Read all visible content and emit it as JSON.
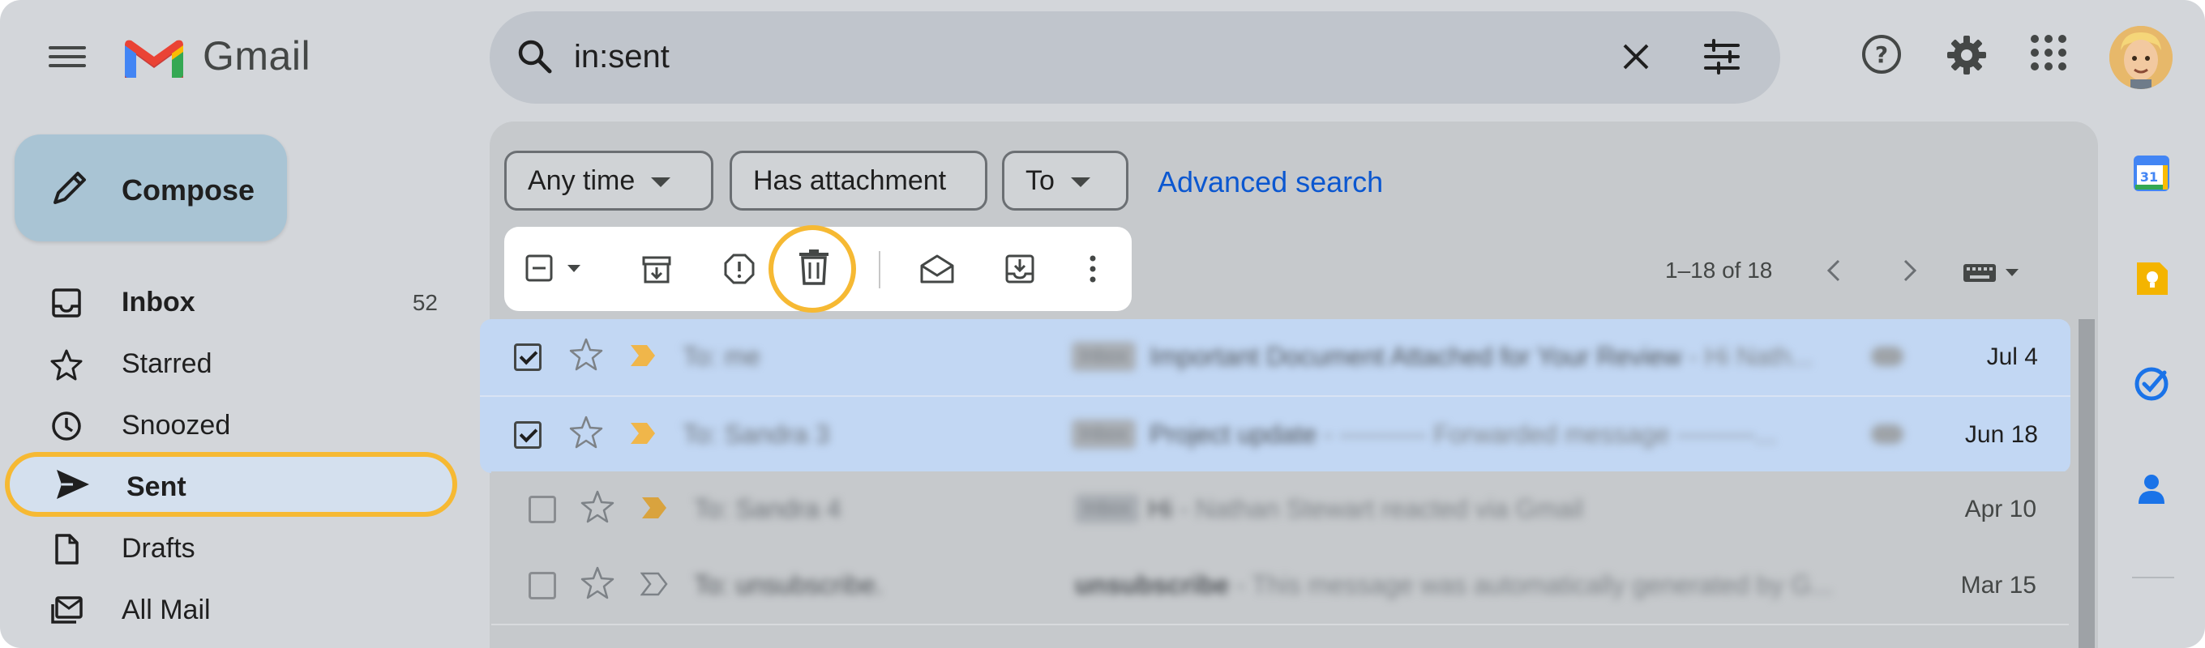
{
  "app": {
    "name": "Gmail"
  },
  "search": {
    "query": "in:sent"
  },
  "compose": {
    "label": "Compose"
  },
  "sidebar": {
    "items": [
      {
        "label": "Inbox",
        "count": "52",
        "icon": "inbox-icon"
      },
      {
        "label": "Starred",
        "icon": "star-icon"
      },
      {
        "label": "Snoozed",
        "icon": "clock-icon"
      },
      {
        "label": "Sent",
        "icon": "send-icon",
        "selected": true
      },
      {
        "label": "Drafts",
        "icon": "draft-icon"
      },
      {
        "label": "All Mail",
        "icon": "all-mail-icon"
      }
    ]
  },
  "filters": {
    "chips": [
      "Any time",
      "Has attachment",
      "To"
    ],
    "advanced": "Advanced search"
  },
  "pager": {
    "range": "1–18 of 18"
  },
  "emails": [
    {
      "sender": "To: me",
      "label": "Inbox",
      "subject": "Important Document Attached for Your Review",
      "snippet": " - Hi Nath...",
      "date": "Jul 4",
      "selected": true
    },
    {
      "sender": "To: Sandra 3",
      "label": "Inbox",
      "subject": "Project update",
      "snippet": " - ---------- Forwarded message ---------...",
      "date": "Jun 18",
      "selected": true
    },
    {
      "sender": "To: Sandra 4",
      "label": "Inbox",
      "subject": "Hi",
      "snippet": " - Nathan Stewart reacted via Gmail",
      "date": "Apr 10",
      "selected": false
    },
    {
      "sender": "To: unsubscribe.",
      "label": "",
      "subject": "unsubscribe",
      "snippet": " - This message was automatically generated by G...",
      "date": "Mar 15",
      "selected": false
    }
  ],
  "colors": {
    "highlight": "#f6b933",
    "selected_row": "#c2d7f3",
    "link": "#0b57d0"
  }
}
